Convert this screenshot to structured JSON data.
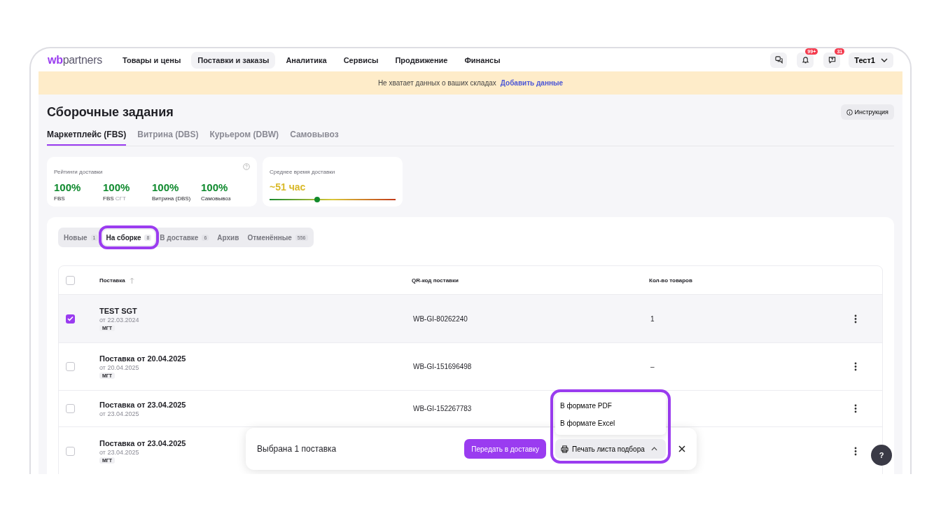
{
  "header": {
    "logo": {
      "part_1": "wb",
      "part_2": "partners"
    },
    "nav": [
      {
        "label": "Товары и цены",
        "selected": false
      },
      {
        "label": "Поставки и заказы",
        "selected": true
      },
      {
        "label": "Аналитика",
        "selected": false
      },
      {
        "label": "Сервисы",
        "selected": false
      },
      {
        "label": "Продвижение",
        "selected": false
      },
      {
        "label": "Финансы",
        "selected": false
      }
    ],
    "actions": [
      {
        "kind": "chat"
      },
      {
        "kind": "bell",
        "badge": "99+"
      },
      {
        "kind": "question",
        "badge": "31"
      }
    ],
    "user": "Тест1"
  },
  "banner": {
    "text": "Не хватает данных о ваших складах",
    "link": "Добавить данные"
  },
  "page": {
    "title": "Сборочные задания",
    "help_button": "Инструкция"
  },
  "tabs": [
    {
      "label": "Маркетплейс (FBS)",
      "selected": true
    },
    {
      "label": "Витрина (DBS)",
      "selected": false
    },
    {
      "label": "Курьером (DBW)",
      "selected": false
    },
    {
      "label": "Самовывоз",
      "selected": false
    }
  ],
  "ratings": {
    "title": "Рейтинги доставки",
    "items": [
      {
        "value": "100%",
        "label": "FBS"
      },
      {
        "value": "100%",
        "label": "FBS",
        "note": "СГТ"
      },
      {
        "value": "100%",
        "label": "Витрина (DBS)"
      },
      {
        "value": "100%",
        "label": "Самовывоз"
      }
    ]
  },
  "delivery_time": {
    "title": "Среднее время доставки",
    "value": "~51 час",
    "level": 0.38
  },
  "status_tabs": [
    {
      "label": "Новые",
      "count": "1",
      "selected": false,
      "highlighted": false
    },
    {
      "label": "На сборке",
      "count": "8",
      "selected": true,
      "highlighted": true
    },
    {
      "label": "В доставке",
      "count": "6",
      "selected": false,
      "highlighted": false
    },
    {
      "label": "Архив",
      "selected": false,
      "highlighted": false
    },
    {
      "label": "Отменённые",
      "count": "556",
      "selected": false,
      "highlighted": false
    }
  ],
  "table": {
    "select_all_checked": false,
    "columns": [
      "Поставка",
      "QR-код поставки",
      "Кол-во товаров"
    ],
    "rows": [
      {
        "name": "TEST SGT",
        "date": "от 22.03.2024",
        "tag": "МГТ",
        "qr": "WB-GI-80262240",
        "count": "1",
        "checked": true
      },
      {
        "name": "Поставка от 20.04.2025",
        "date": "от 20.04.2025",
        "tag": "МГТ",
        "qr": "WB-GI-151696498",
        "count": "–",
        "checked": false
      },
      {
        "name": "Поставка от 23.04.2025",
        "date": "от 23.04.2025",
        "qr": "WB-GI-152267783",
        "checked": false
      },
      {
        "name": "Поставка от 23.04.2025",
        "date": "от 23.04.2025",
        "tag": "МГТ",
        "checked": false
      }
    ]
  },
  "selection_bar": {
    "text": "Выбрана 1 поставка",
    "primary_button": "Передать в доставку",
    "print_button": "Печать листа подбора",
    "menu_open": true,
    "highlighted": true,
    "menu_items": [
      "В формате PDF",
      "В формате Excel"
    ]
  },
  "help": "?"
}
